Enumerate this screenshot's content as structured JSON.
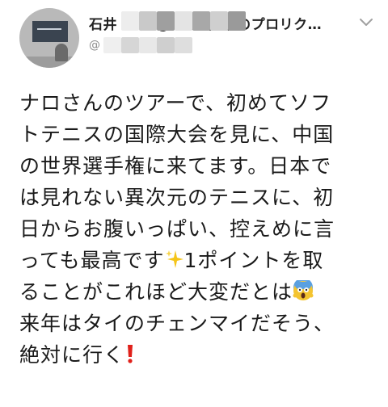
{
  "tweet": {
    "author": {
      "name": "石井 宏明 @ 長野県 初のプロリク…",
      "handle": "@"
    },
    "content_lines": [
      "ナロさんのツアーで、初めてソフ",
      "トテニスの国際大会を見に、中国",
      "の世界選手権に来てます。日本で",
      "は見れない異次元のテニスに、初",
      "日からお腹いっぱい、控えめに言",
      "っても最高です",
      "1ポイントを取",
      "ることがこれほど大変だとは",
      "来年はタイのチェンマイだそう、",
      "絶対に行く"
    ]
  },
  "icons": {
    "chevron": "chevron-down-icon",
    "sparkles": "sparkles-icon",
    "screaming": "screaming-face-icon",
    "exclamation": "red-exclamation-icon"
  },
  "colors": {
    "text": "#1a1a1a",
    "muted": "#8a8a8a",
    "sparkle": "#f5c518",
    "exclamation": "#e0201a"
  }
}
